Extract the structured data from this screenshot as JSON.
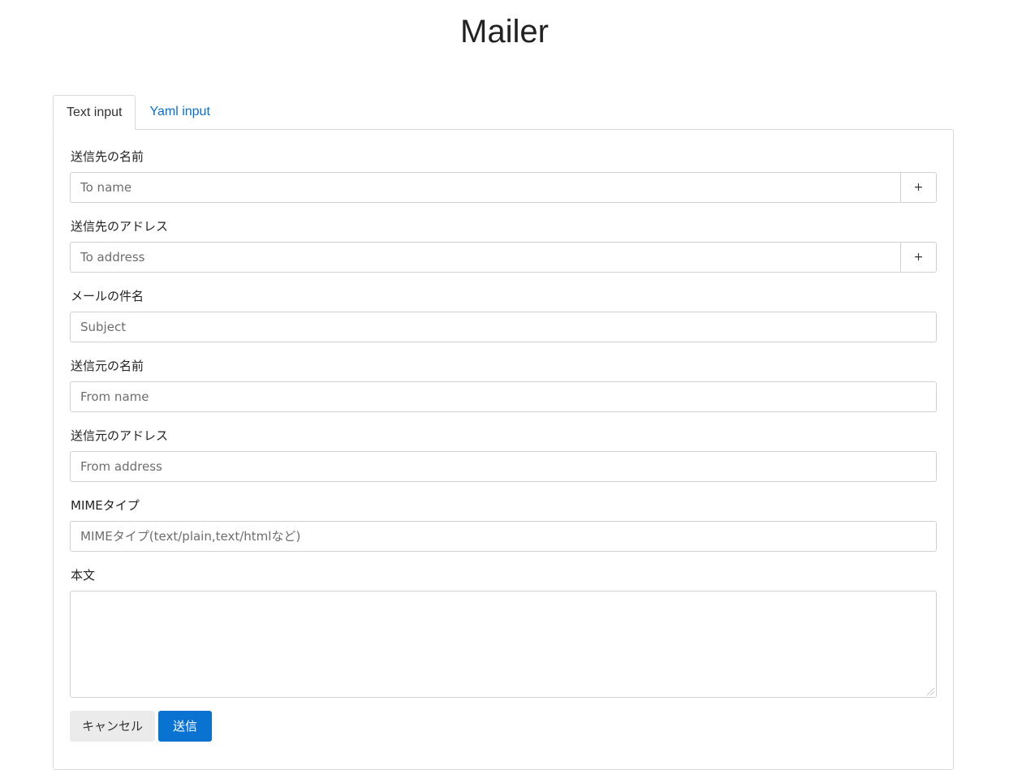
{
  "app": {
    "title": "Mailer"
  },
  "tabs": [
    {
      "label": "Text input",
      "active": true
    },
    {
      "label": "Yaml input",
      "active": false
    }
  ],
  "form": {
    "to_name": {
      "label": "送信先の名前",
      "placeholder": "To name",
      "value": "",
      "add_label": "+"
    },
    "to_address": {
      "label": "送信先のアドレス",
      "placeholder": "To address",
      "value": "",
      "add_label": "+"
    },
    "subject": {
      "label": "メールの件名",
      "placeholder": "Subject",
      "value": ""
    },
    "from_name": {
      "label": "送信元の名前",
      "placeholder": "From name",
      "value": ""
    },
    "from_address": {
      "label": "送信元のアドレス",
      "placeholder": "From address",
      "value": ""
    },
    "mime_type": {
      "label": "MIMEタイプ",
      "placeholder": "MIMEタイプ(text/plain,text/htmlなど)",
      "value": ""
    },
    "body": {
      "label": "本文",
      "value": ""
    }
  },
  "actions": {
    "cancel_label": "キャンセル",
    "submit_label": "送信"
  },
  "colors": {
    "accent": "#0a73d2",
    "link": "#0a6fc9",
    "cancel_bg": "#ebebeb",
    "border": "#d1d1d1"
  }
}
